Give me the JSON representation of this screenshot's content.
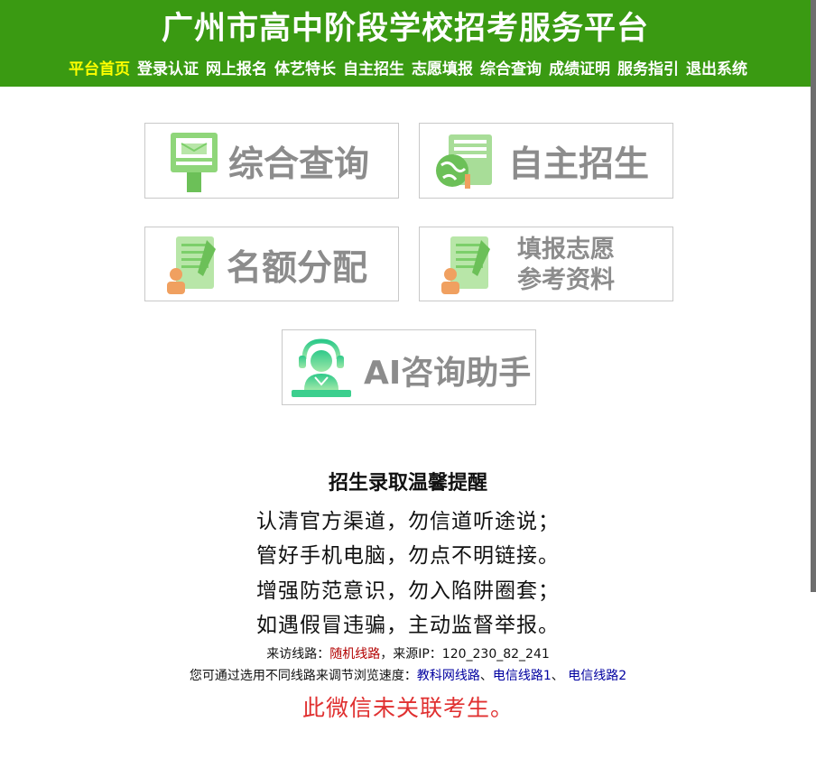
{
  "header": {
    "title": "广州市高中阶段学校招考服务平台",
    "nav": [
      {
        "label": "平台首页",
        "active": true
      },
      {
        "label": "登录认证"
      },
      {
        "label": "网上报名"
      },
      {
        "label": "体艺特长"
      },
      {
        "label": "自主招生"
      },
      {
        "label": "志愿填报"
      },
      {
        "label": "综合查询"
      },
      {
        "label": "成绩证明"
      },
      {
        "label": "服务指引"
      },
      {
        "label": "退出系统"
      }
    ]
  },
  "tiles": {
    "query": "综合查询",
    "self_admission": "自主招生",
    "quota": "名额分配",
    "reference_line1": "填报志愿",
    "reference_line2": "参考资料",
    "ai": "AI咨询助手"
  },
  "reminder": {
    "title": "招生录取温馨提醒",
    "lines": [
      "认清官方渠道，勿信道听途说；",
      "管好手机电脑，勿点不明链接。",
      "增强防范意识，勿入陷阱圈套；",
      "如遇假冒违骗，主动监督举报。"
    ]
  },
  "access": {
    "route_label": "来访线路：",
    "route_value": "随机线路",
    "ip_label": "，来源IP：",
    "ip_value": "120_230_82_241",
    "hint": "您可通过选用不同线路来调节浏览速度：",
    "links": [
      "教科网线路",
      "电信线路1",
      "电信线路2"
    ],
    "sep1": "、",
    "sep2": "、"
  },
  "wechat_note": "此微信未关联考生。",
  "colors": {
    "header_green": "#3a9a12",
    "active_nav": "#ffff00",
    "tile_text": "#8c8c8c",
    "icon_green": "#7ccf6a",
    "link_blue": "#0000a0",
    "warning_red": "#e03030"
  }
}
